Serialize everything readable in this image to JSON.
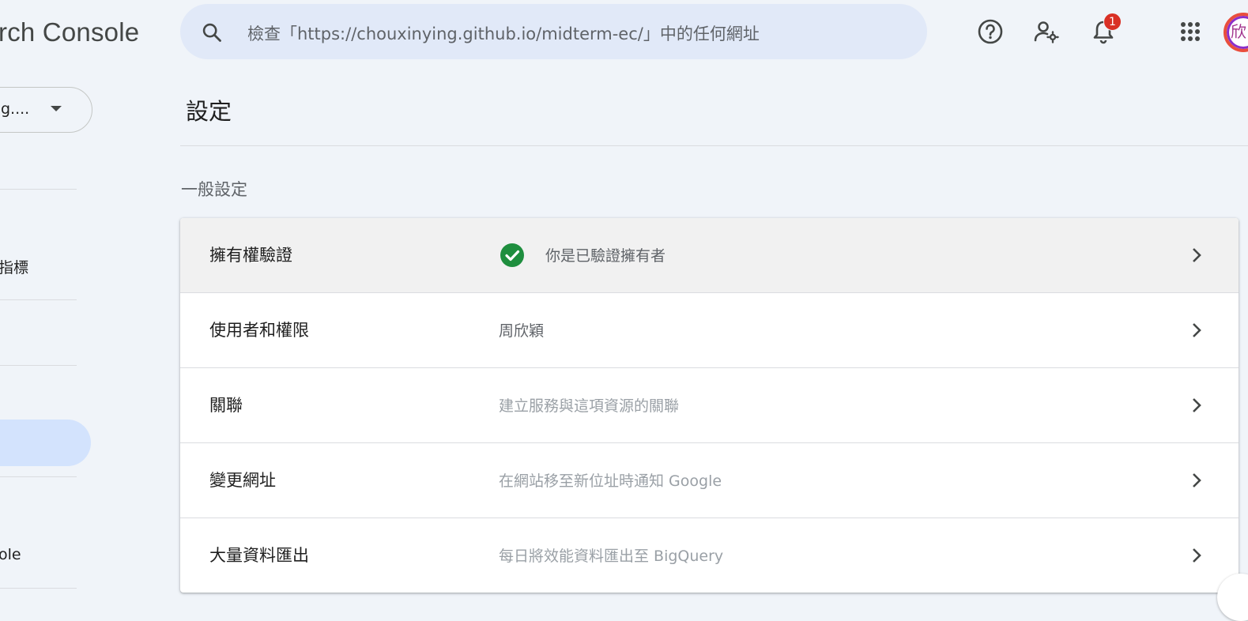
{
  "app": {
    "title": "rch Console"
  },
  "search": {
    "placeholder": "檢查「https://chouxinying.github.io/midterm-ec/」中的任何網址"
  },
  "notifications": {
    "count": "1"
  },
  "avatar": {
    "initial": "欣"
  },
  "sidebar": {
    "property_label": "g....",
    "items": [
      {
        "label": "指標"
      },
      {
        "label": "ole"
      }
    ]
  },
  "page": {
    "title": "設定",
    "section": "一般設定"
  },
  "settings_rows": [
    {
      "label": "擁有權驗證",
      "value": "你是已驗證擁有者"
    },
    {
      "label": "使用者和權限",
      "value": "周欣穎"
    },
    {
      "label": "關聯",
      "value": "建立服務與這項資源的關聯"
    },
    {
      "label": "變更網址",
      "value": "在網站移至新位址時通知 Google"
    },
    {
      "label": "大量資料匯出",
      "value": "每日將效能資料匯出至 BigQuery"
    }
  ],
  "colors": {
    "background": "#f0f4f9",
    "search_bg": "#e1e9f8",
    "active_nav": "#d3e3fd",
    "verified_green": "#1e8e3e",
    "badge_red": "#d93025"
  },
  "icons": [
    "search-icon",
    "help-icon",
    "manage-users-icon",
    "bell-icon",
    "apps-icon",
    "check-circle-icon",
    "chevron-right-icon",
    "caret-down-icon"
  ]
}
